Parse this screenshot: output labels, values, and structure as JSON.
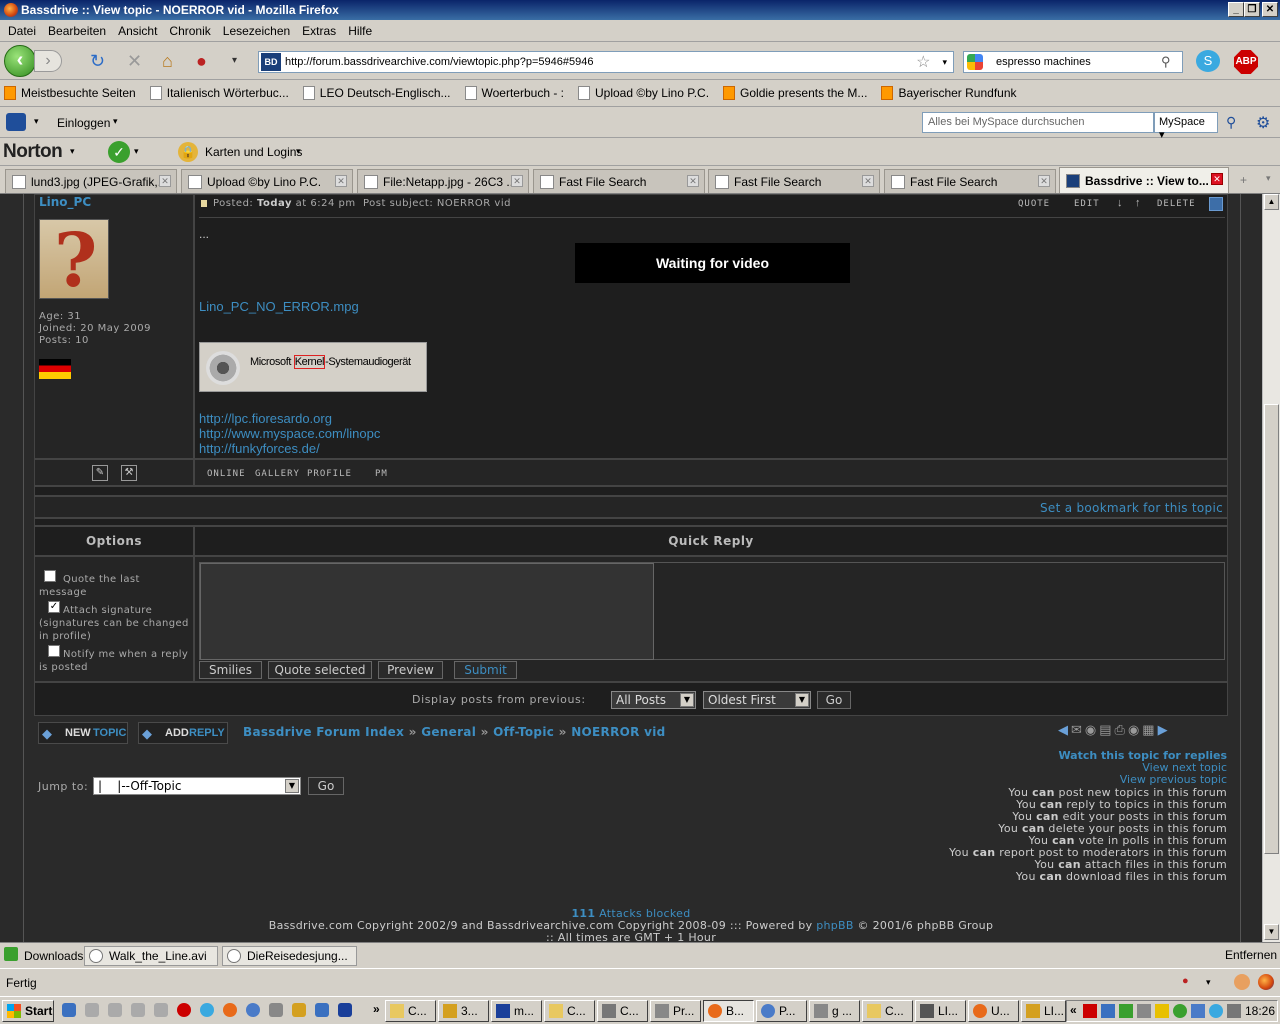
{
  "window": {
    "title": "Bassdrive :: View topic - NOERROR vid - Mozilla Firefox"
  },
  "menu": [
    "Datei",
    "Bearbeiten",
    "Ansicht",
    "Chronik",
    "Lesezeichen",
    "Extras",
    "Hilfe"
  ],
  "nav": {
    "url": "http://forum.bassdrivearchive.com/viewtopic.php?p=5946#5946",
    "site_icon": "BD",
    "search_value": "espresso machines"
  },
  "bookmarks": [
    "Meistbesuchte Seiten",
    "Italienisch Wörterbuc...",
    "LEO Deutsch-Englisch...",
    "Woerterbuch - :",
    "Upload ©by Lino P.C.",
    "Goldie presents the M...",
    "Bayerischer Rundfunk"
  ],
  "myspace": {
    "login": "Einloggen",
    "search_placeholder": "Alles bei MySpace durchsuchen",
    "scope": "MySpace"
  },
  "norton": {
    "logo": "Norton",
    "logins": "Karten und Logins"
  },
  "tabs": [
    {
      "label": "lund3.jpg (JPEG-Grafik,..."
    },
    {
      "label": "Upload ©by Lino P.C."
    },
    {
      "label": "File:Netapp.jpg - 26C3 ..."
    },
    {
      "label": "Fast File Search"
    },
    {
      "label": "Fast File Search"
    },
    {
      "label": "Fast File Search"
    },
    {
      "label": "Bassdrive :: View to..."
    }
  ],
  "post": {
    "author": "Lino_PC",
    "age": "Age: 31",
    "joined": "Joined: 20 May 2009",
    "posts": "Posts: 10",
    "header_posted": "Posted:",
    "header_when": "Today",
    "header_time": "at 6:24 pm",
    "header_subject": "Post subject:  NOERROR vid",
    "actions": [
      "QUOTE",
      "EDIT",
      "DELETE"
    ],
    "ellipsis": "...",
    "video_text": "Waiting for video",
    "file_link": "Lino_PC_NO_ERROR.mpg",
    "device_text_a": "Microsoft ",
    "device_text_b": "Kernel",
    "device_text_c": "-Systemaudiogerät",
    "links": [
      "http://lpc.fioresardo.org",
      "http://www.myspace.com/linopc",
      "http://funkyforces.de/"
    ],
    "profile_links": [
      "ONLINE",
      "GALLERY",
      "PROFILE",
      "PM"
    ]
  },
  "bookmark_link": "Set a bookmark for this topic",
  "options": {
    "title": "Options",
    "quote_last": "Quote the last message",
    "attach_sig": "Attach signature (signatures can be changed in profile)",
    "notify": "Notify me when a reply is posted"
  },
  "quick_reply": {
    "title": "Quick Reply",
    "buttons": [
      "Smilies",
      "Quote selected",
      "Preview",
      "Submit"
    ]
  },
  "display": {
    "label": "Display posts from previous:",
    "range": "All Posts",
    "order": "Oldest First",
    "go": "Go"
  },
  "breadcrumb": {
    "new_topic_a": "NEW",
    "new_topic_b": "TOPIC",
    "add_reply_a": "ADD",
    "add_reply_b": "REPLY",
    "items": [
      "Bassdrive Forum Index",
      "General",
      "Off-Topic",
      "NOERROR vid"
    ],
    "sep": "»"
  },
  "jump": {
    "label": "Jump to:",
    "value": "|    |--Off-Topic",
    "go": "Go"
  },
  "topic_links": [
    "Watch this topic for replies",
    "View next topic",
    "View previous topic"
  ],
  "permissions": [
    [
      "You",
      "can",
      "post new topics in this forum"
    ],
    [
      "You",
      "can",
      "reply to topics in this forum"
    ],
    [
      "You",
      "can",
      "edit your posts in this forum"
    ],
    [
      "You",
      "can",
      "delete your posts in this forum"
    ],
    [
      "You",
      "can",
      "vote in polls in this forum"
    ],
    [
      "You",
      "can",
      "report post to moderators in this forum"
    ],
    [
      "You",
      "can",
      "attach files in this forum"
    ],
    [
      "You",
      "can",
      "download files in this forum"
    ]
  ],
  "footer": {
    "attacks_count": "111",
    "attacks_text": "Attacks blocked",
    "copyright_a": "Bassdrive.com Copyright 2002/9 and Bassdrivearchive.com Copyright 2008-09 ::: Powered by",
    "phpbb": "phpBB",
    "copyright_b": "© 2001/6 phpBB Group",
    "tz": ":: All times are GMT + 1 Hour"
  },
  "downloads": {
    "label": "Downloads",
    "items": [
      "Walk_the_Line.avi",
      "DieReisedesjung..."
    ],
    "remove": "Entfernen"
  },
  "status": "Fertig",
  "taskbar": {
    "start": "Start",
    "tasks": [
      "C...",
      "3...",
      "m...",
      "C...",
      "C...",
      "Pr...",
      "B...",
      "P...",
      "g ...",
      "C...",
      "LI...",
      "U...",
      "LI..."
    ],
    "clock": "18:26"
  },
  "colors": {
    "page_bg": "#2a2a2a",
    "link": "#3d8ec2",
    "panel": "#1e1e1e"
  }
}
